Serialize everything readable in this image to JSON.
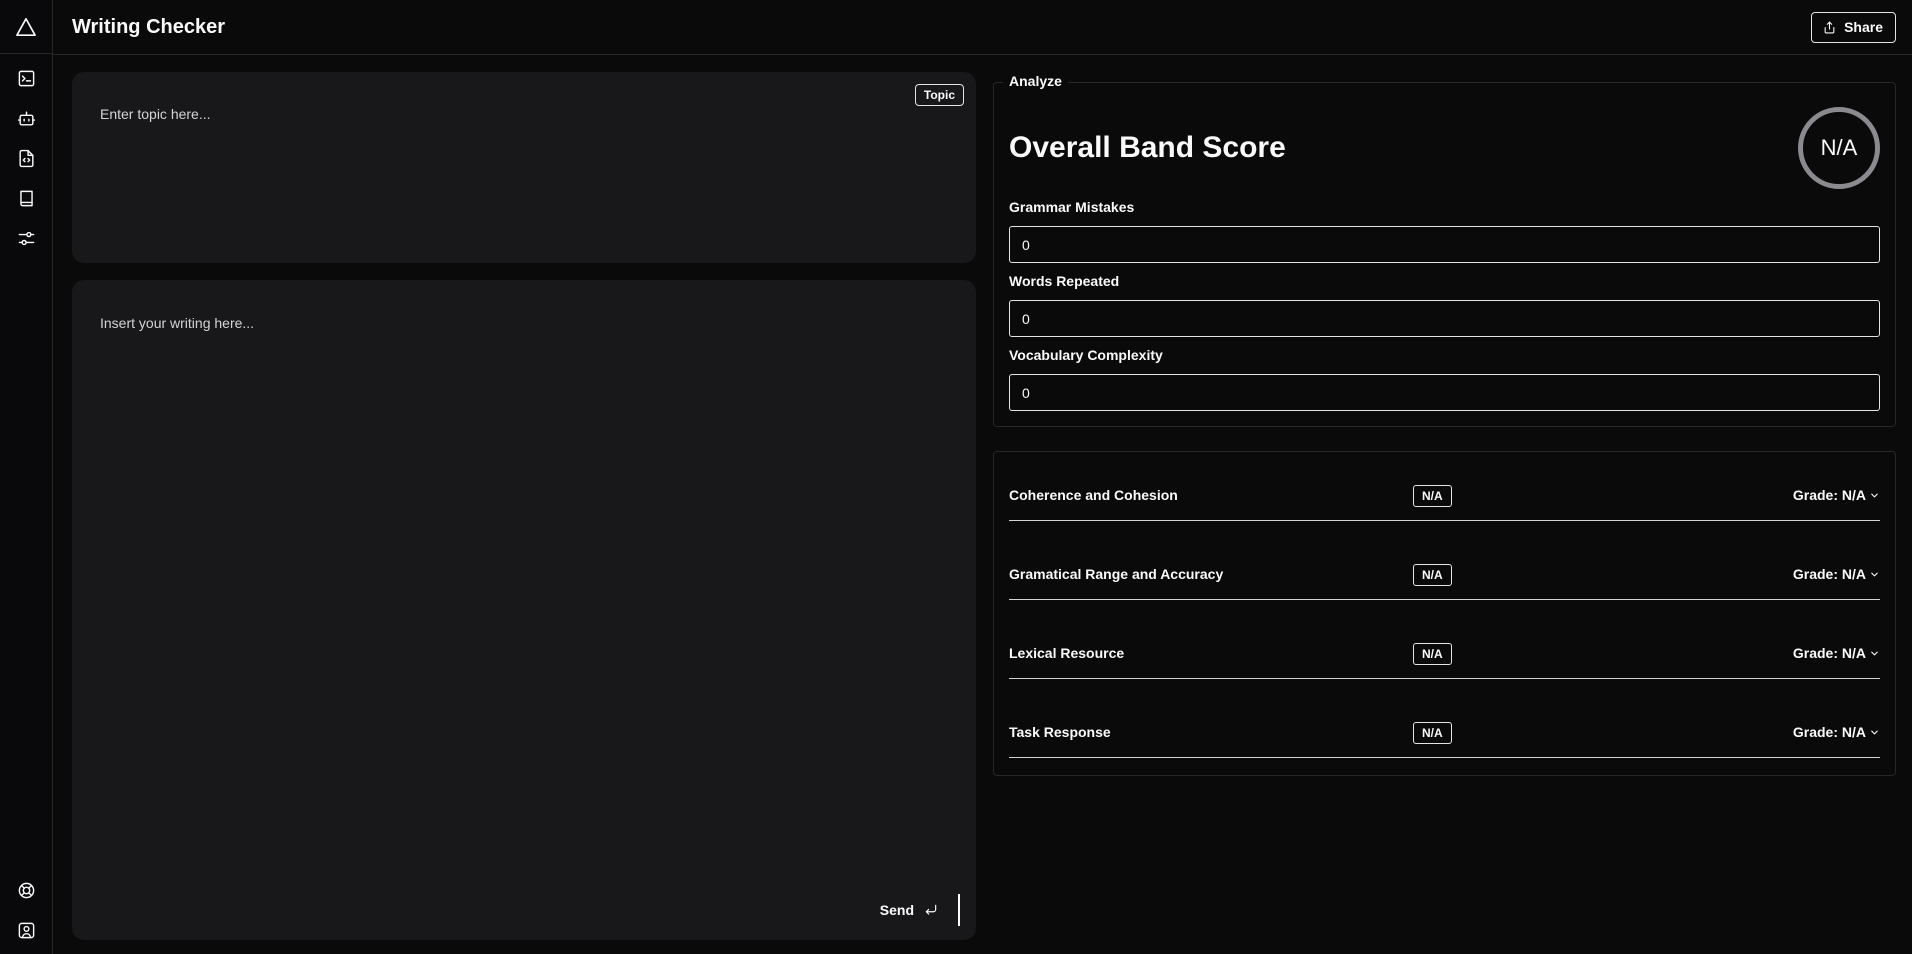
{
  "header": {
    "title": "Writing Checker",
    "share_label": "Share"
  },
  "sidebar": {
    "items": [
      {
        "name": "terminal-icon"
      },
      {
        "name": "bot-icon"
      },
      {
        "name": "file-code-icon"
      },
      {
        "name": "book-icon"
      },
      {
        "name": "settings-sliders-icon"
      }
    ],
    "bottom": [
      {
        "name": "help-lifebuoy-icon"
      },
      {
        "name": "user-profile-icon"
      }
    ]
  },
  "topic": {
    "placeholder": "Enter topic here...",
    "badge": "Topic"
  },
  "writing": {
    "placeholder": "Insert your writing here...",
    "send_label": "Send"
  },
  "analyze": {
    "legend": "Analyze",
    "band_title": "Overall Band Score",
    "band_score": "N/A",
    "fields": [
      {
        "label": "Grammar Mistakes",
        "value": "0"
      },
      {
        "label": "Words Repeated",
        "value": "0"
      },
      {
        "label": "Vocabulary Complexity",
        "value": "0"
      }
    ]
  },
  "criteria": [
    {
      "name": "Coherence and Cohesion",
      "badge": "N/A",
      "grade": "Grade: N/A"
    },
    {
      "name": "Gramatical Range and Accuracy",
      "badge": "N/A",
      "grade": "Grade: N/A"
    },
    {
      "name": "Lexical Resource",
      "badge": "N/A",
      "grade": "Grade: N/A"
    },
    {
      "name": "Task Response",
      "badge": "N/A",
      "grade": "Grade: N/A"
    }
  ]
}
